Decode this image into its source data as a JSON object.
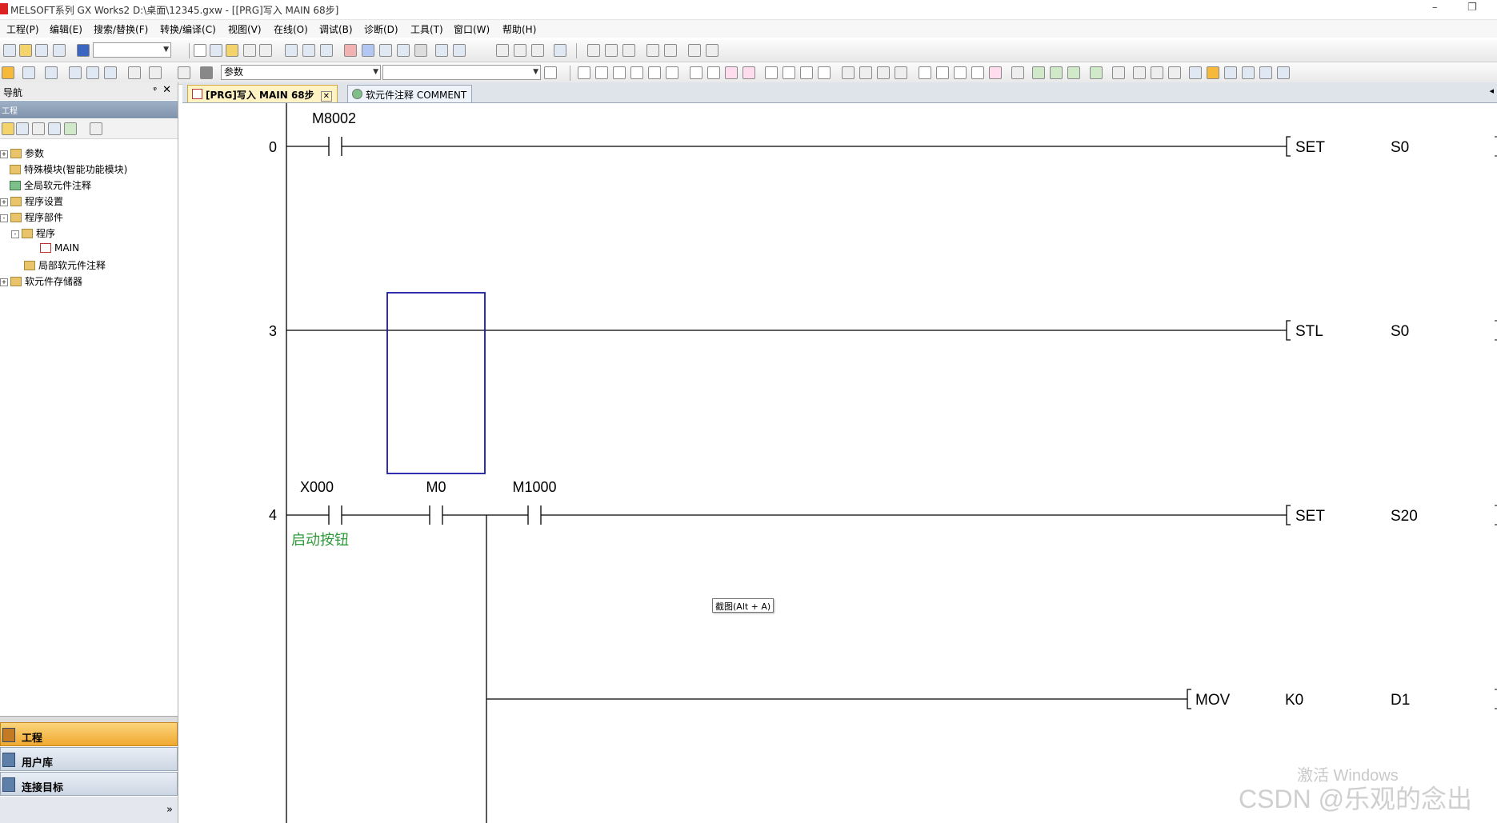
{
  "window": {
    "title": "MELSOFT系列 GX Works2 D:\\桌面\\12345.gxw - [[PRG]写入 MAIN 68步]",
    "minimize_glyph": "–",
    "restore_glyph": "❐"
  },
  "menu": [
    "工程(P)",
    "编辑(E)",
    "搜索/替换(F)",
    "转换/编译(C)",
    "视图(V)",
    "在线(O)",
    "调试(B)",
    "诊断(D)",
    "工具(T)",
    "窗口(W)",
    "帮助(H)"
  ],
  "toolbar2": {
    "combo_label": "参数"
  },
  "navigation": {
    "title": "导航",
    "pin_glyph": "ᵠ",
    "close_glyph": "✕",
    "band_label": "工程",
    "tree": [
      {
        "label": "参数",
        "expander": "+"
      },
      {
        "label": "特殊模块(智能功能模块)",
        "expander": ""
      },
      {
        "label": "全局软元件注释",
        "expander": ""
      },
      {
        "label": "程序设置",
        "expander": "+"
      },
      {
        "label": "程序部件",
        "expander": "-"
      },
      {
        "label": "程序",
        "expander": "-"
      },
      {
        "label": "MAIN",
        "expander": ""
      },
      {
        "label": "局部软元件注释",
        "expander": ""
      },
      {
        "label": "软元件存储器",
        "expander": "+"
      }
    ],
    "bottom_buttons": [
      "工程",
      "用户库",
      "连接目标"
    ],
    "more_glyph": "»"
  },
  "tabs": [
    {
      "label": "[PRG]写入 MAIN 68步",
      "close": "✕"
    },
    {
      "label": "软元件注释 COMMENT"
    }
  ],
  "ladder": {
    "rungs": [
      {
        "step": "0",
        "contacts": [
          "M8002"
        ],
        "instruction": "SET",
        "operand1": "",
        "operand2": "S0"
      },
      {
        "step": "3",
        "contacts": [],
        "instruction": "STL",
        "operand1": "",
        "operand2": "S0"
      },
      {
        "step": "4",
        "contacts": [
          "X000",
          "M0",
          "M1000"
        ],
        "comment": "启动按钮",
        "instruction": "SET",
        "operand1": "",
        "operand2": "S20"
      },
      {
        "step": "",
        "contacts": [],
        "instruction": "MOV",
        "operand1": "K0",
        "operand2": "D1"
      }
    ]
  },
  "tooltip": "截图(Alt + A)",
  "watermark": {
    "line1": "激活 Windows",
    "line2": "CSDN @乐观的念出"
  },
  "colors": {
    "cursor_box": "#1a1aa6",
    "comment_text": "#2e9a3a",
    "active_tab": "#fff3c4",
    "nav_selected": "#f7b93a"
  }
}
